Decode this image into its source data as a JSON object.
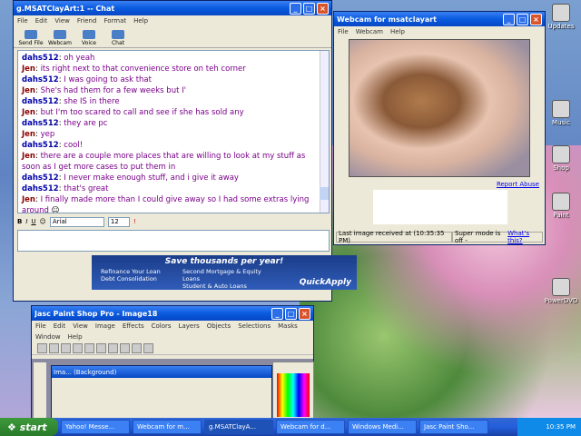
{
  "chat": {
    "title": "g.MSATClayArt:1 -- Chat",
    "menu": [
      "File",
      "Edit",
      "View",
      "Friend",
      "Format",
      "Help"
    ],
    "tools": [
      "Send File",
      "Webcam",
      "Voice",
      "Chat"
    ],
    "messages": [
      {
        "who": "dahs512",
        "text": "oh yeah"
      },
      {
        "who": "Jen",
        "text": "its right next to that convenience store on teh corner"
      },
      {
        "who": "dahs512",
        "text": "I was going to ask that"
      },
      {
        "who": "Jen",
        "text": "She's had them for a few weeks but I'"
      },
      {
        "who": "dahs512",
        "text": "she IS in there"
      },
      {
        "who": "Jen",
        "text": "but I'm too scared to call and see if she has sold any"
      },
      {
        "who": "dahs512",
        "text": "they are pc"
      },
      {
        "who": "Jen",
        "text": "yep"
      },
      {
        "who": "dahs512",
        "text": "cool!"
      },
      {
        "who": "Jen",
        "text": "there are a couple more places that are willing to look at my stuff as soon as I get more cases to put them in"
      },
      {
        "who": "dahs512",
        "text": "I never make enough stuff, and i give it away"
      },
      {
        "who": "dahs512",
        "text": "that's great"
      },
      {
        "who": "Jen",
        "text": "I finally made more than I could give away so I had some extras lying around"
      }
    ],
    "font": "Arial",
    "size": "12",
    "ad": {
      "headline": "Save thousands per year!",
      "items": [
        "Refinance Your Loan",
        "Debt Consolidation",
        "Second Mortgage & Equity Loans",
        "Student & Auto Loans"
      ],
      "brand": "QuickApply"
    }
  },
  "cam": {
    "title": "Webcam for msatclayart",
    "menu": [
      "File",
      "Webcam",
      "Help"
    ],
    "report": "Report Abuse",
    "last_image": "Last image received at (10:35:35 PM)",
    "super_mode": "Super mode is off -",
    "whats_this": "What's this?"
  },
  "psp": {
    "title": "Jasc Paint Shop Pro - Image18",
    "menu": [
      "File",
      "Edit",
      "View",
      "Image",
      "Effects",
      "Colors",
      "Layers",
      "Objects",
      "Selections",
      "Masks",
      "Window",
      "Help"
    ],
    "inner_title": "Ima... (Background)"
  },
  "desktop": {
    "icons": [
      "Updates",
      "Music",
      "Shop",
      "Paint",
      "PowerDVD"
    ]
  },
  "taskbar": {
    "start": "start",
    "tasks": [
      "Yahoo! Messe...",
      "Webcam for m...",
      "g.MSATClayA...",
      "Webcam for d...",
      "Windows Medi...",
      "Jasc Paint Sho..."
    ],
    "clock": "10:35 PM"
  }
}
